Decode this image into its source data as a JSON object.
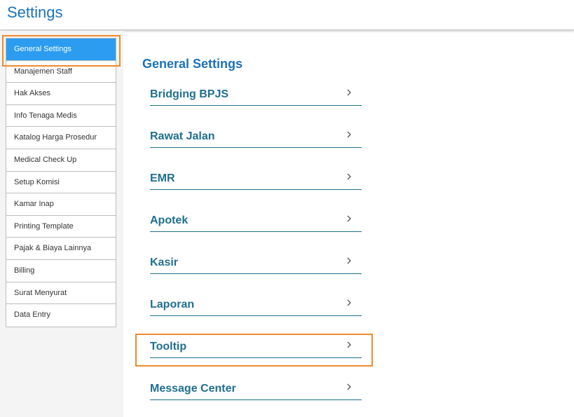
{
  "header": {
    "title": "Settings"
  },
  "sidebar": {
    "items": [
      {
        "label": "General Settings",
        "active": true
      },
      {
        "label": "Manajemen Staff"
      },
      {
        "label": "Hak Akses"
      },
      {
        "label": "Info Tenaga Medis"
      },
      {
        "label": "Katalog Harga Prosedur"
      },
      {
        "label": "Medical Check Up"
      },
      {
        "label": "Setup Komisi"
      },
      {
        "label": "Kamar Inap"
      },
      {
        "label": "Printing Template"
      },
      {
        "label": "Pajak & Biaya Lainnya"
      },
      {
        "label": "Billing"
      },
      {
        "label": "Surat Menyurat"
      },
      {
        "label": "Data Entry"
      }
    ]
  },
  "main": {
    "title": "General Settings",
    "settings": [
      {
        "label": "Bridging BPJS",
        "icon": "chevron-right-icon"
      },
      {
        "label": "Rawat Jalan",
        "icon": "chevron-right-icon"
      },
      {
        "label": "EMR",
        "icon": "chevron-right-icon"
      },
      {
        "label": "Apotek",
        "icon": "chevron-right-icon"
      },
      {
        "label": "Kasir",
        "icon": "chevron-right-icon"
      },
      {
        "label": "Laporan",
        "icon": "chevron-right-icon"
      },
      {
        "label": "Tooltip",
        "icon": "chevron-right-icon"
      },
      {
        "label": "Message Center",
        "icon": "chevron-right-icon"
      }
    ]
  },
  "colors": {
    "accent": "#1c72b8",
    "active_bg": "#2b9cf0",
    "link": "#1f6f8f",
    "highlight": "#ef8a2e"
  }
}
